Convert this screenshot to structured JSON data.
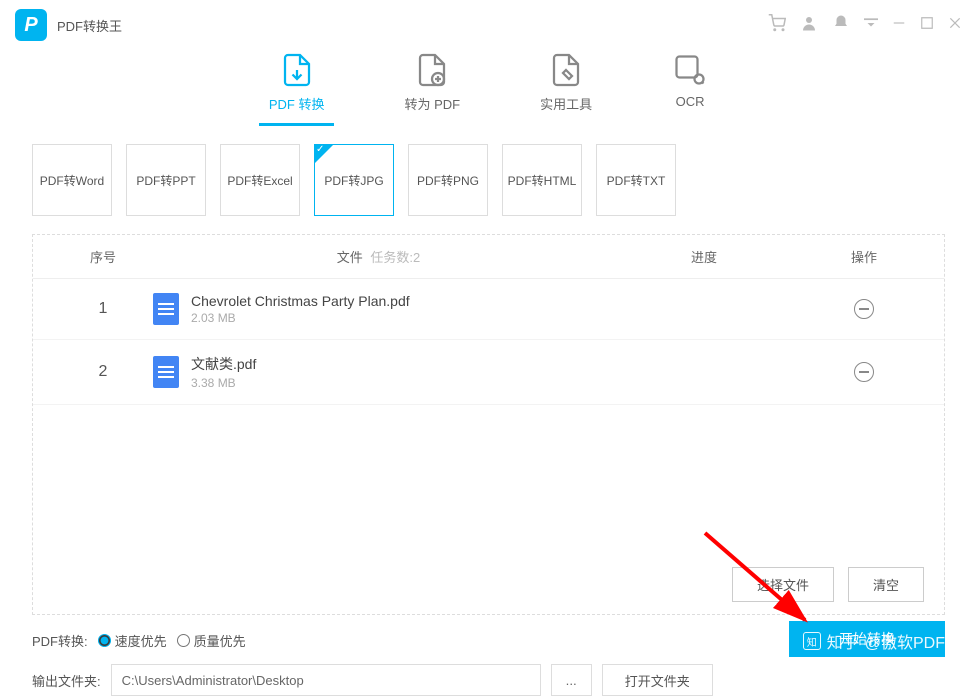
{
  "app": {
    "title": "PDF转换王"
  },
  "maintabs": [
    {
      "label": "PDF 转换",
      "active": true
    },
    {
      "label": "转为 PDF",
      "active": false
    },
    {
      "label": "实用工具",
      "active": false
    },
    {
      "label": "OCR",
      "active": false
    }
  ],
  "subtiles": [
    {
      "label": "PDF转Word"
    },
    {
      "label": "PDF转PPT"
    },
    {
      "label": "PDF转Excel"
    },
    {
      "label": "PDF转JPG"
    },
    {
      "label": "PDF转PNG"
    },
    {
      "label": "PDF转HTML"
    },
    {
      "label": "PDF转TXT"
    }
  ],
  "subtile_active_index": 3,
  "table": {
    "head_idx": "序号",
    "head_file": "文件",
    "head_task_prefix": "任务数:",
    "task_count": "2",
    "head_progress": "进度",
    "head_op": "操作"
  },
  "files": [
    {
      "idx": "1",
      "name": "Chevrolet Christmas Party Plan.pdf",
      "size": "2.03 MB"
    },
    {
      "idx": "2",
      "name": "文献类.pdf",
      "size": "3.38 MB"
    }
  ],
  "panel_actions": {
    "select": "选择文件",
    "clear": "清空"
  },
  "settings": {
    "convert_label": "PDF转换:",
    "speed_priority": "速度优先",
    "quality_priority": "质量优先",
    "output_label": "输出文件夹:",
    "output_path": "C:\\Users\\Administrator\\Desktop",
    "open_folder": "打开文件夹",
    "start": "开始转换"
  },
  "watermark": {
    "brand": "知乎",
    "handle": "@傲软PDF"
  }
}
